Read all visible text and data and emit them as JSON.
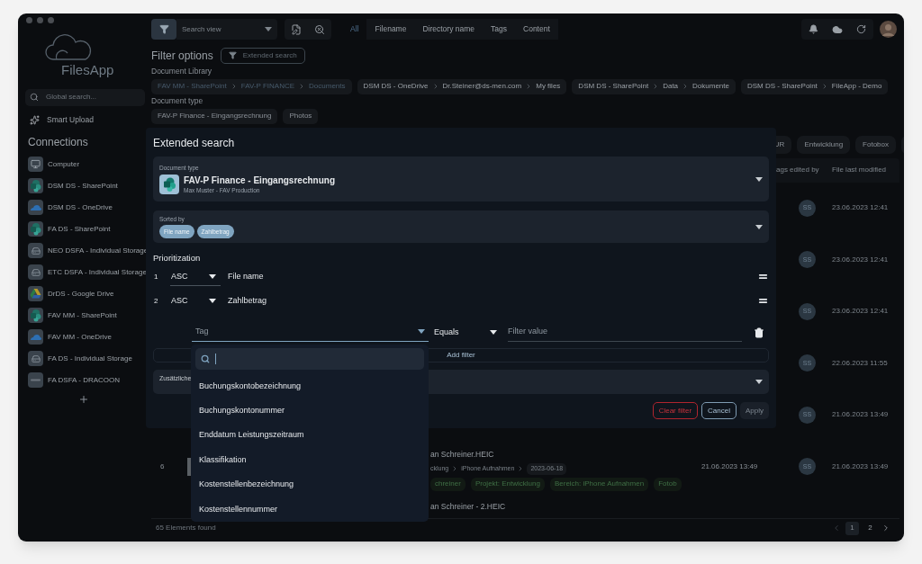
{
  "sidebar": {
    "brand": "FilesApp",
    "search": {
      "placeholder": "Global search..."
    },
    "smart_upload": "Smart Upload",
    "connections_title": "Connections",
    "connections": [
      {
        "label": "Computer",
        "kind": "computer"
      },
      {
        "label": "DSM DS - SharePoint",
        "kind": "sharepoint"
      },
      {
        "label": "DSM DS - OneDrive",
        "kind": "onedrive"
      },
      {
        "label": "FA DS - SharePoint",
        "kind": "sharepoint"
      },
      {
        "label": "NEO DSFA - Individual Storage",
        "kind": "storage"
      },
      {
        "label": "ETC DSFA - Individual Storage",
        "kind": "storage"
      },
      {
        "label": "DrDS - Google Drive",
        "kind": "gdrive"
      },
      {
        "label": "FAV MM - SharePoint",
        "kind": "sharepoint"
      },
      {
        "label": "FAV MM - OneDrive",
        "kind": "onedrive"
      },
      {
        "label": "FA DS - Individual Storage",
        "kind": "storage"
      },
      {
        "label": "FA DSFA - DRACOON",
        "kind": "dracoon"
      }
    ]
  },
  "toolbar": {
    "search_view": {
      "placeholder": "Search view"
    },
    "tabs": [
      {
        "label": "All",
        "selected": true
      },
      {
        "label": "Filename",
        "selected": false
      },
      {
        "label": "Directory name",
        "selected": false
      },
      {
        "label": "Tags",
        "selected": false
      },
      {
        "label": "Content",
        "selected": false
      }
    ]
  },
  "filter_options": {
    "title": "Filter options",
    "extended_search": "Extended search",
    "library_label": "Document Library",
    "libraries": [
      {
        "parts": [
          "FAV MM - SharePoint",
          "FAV-P FINANCE",
          "Documents"
        ],
        "selected": true
      },
      {
        "parts": [
          "DSM DS - OneDrive",
          "Dr.Steiner@ds-men.com",
          "My files"
        ],
        "selected": false
      },
      {
        "parts": [
          "DSM DS - SharePoint",
          "Data",
          "Dokumente"
        ],
        "selected": false
      },
      {
        "parts": [
          "DSM DS - SharePoint",
          "FileApp - Demo"
        ],
        "selected": false
      }
    ],
    "type_label": "Document type",
    "types": [
      "FAV-P Finance - Eingangsrechnung",
      "Photos"
    ],
    "tags": [
      "UR",
      "Entwicklung",
      "Fotobox"
    ]
  },
  "table": {
    "columns": [
      "ags edited by",
      "File last modified"
    ],
    "rows": [
      {
        "editor": "SS",
        "modified": "23.06.2023 12:41"
      },
      {
        "editor": "SS",
        "modified": "23.06.2023 12:41"
      },
      {
        "editor": "SS",
        "modified": "23.06.2023 12:41"
      },
      {
        "editor": "SS",
        "modified": "22.06.2023 11:55"
      },
      {
        "editor": "SS",
        "modified": "21.06.2023 13:49"
      },
      {
        "number": "6",
        "name": "an Schreiner.HEIC",
        "path": [
          "cklung",
          "iPhone Aufnahmen",
          "2023-06-18"
        ],
        "tags": [
          "chreiner",
          "Projekt: Entwicklung",
          "Bereich: iPhone Aufnahmen",
          "Fotob"
        ],
        "created": "21.06.2023 13:49",
        "editor": "SS",
        "modified": "21.06.2023 13:49"
      },
      {
        "name": "an Schreiner - 2.HEIC"
      }
    ]
  },
  "footer": {
    "count": "65 Elements found",
    "pages": [
      {
        "label": "1",
        "selected": true
      },
      {
        "label": "2",
        "selected": false
      }
    ]
  },
  "dialog": {
    "title": "Extended search",
    "document_type": {
      "label": "Document type",
      "value": "FAV-P Finance - Eingangsrechnung",
      "subtitle": "Max Muster - FAV Production"
    },
    "sorted_by": {
      "label": "Sorted by",
      "chips": [
        "File name",
        "Zahlbetrag"
      ]
    },
    "prioritization_title": "Prioritization",
    "prioritization": [
      {
        "index": "1",
        "order": "ASC",
        "field": "File name"
      },
      {
        "index": "2",
        "order": "ASC",
        "field": "Zahlbetrag"
      }
    ],
    "filter": {
      "field": {
        "placeholder": "Tag"
      },
      "operator": "Equals",
      "value": {
        "placeholder": "Filter value"
      }
    },
    "add_filter": "Add filter",
    "additional_label": "Zusätzliche",
    "buttons": [
      {
        "label": "Clear filter",
        "kind": "danger"
      },
      {
        "label": "Cancel",
        "kind": "outline"
      },
      {
        "label": "Apply",
        "kind": "disabled"
      }
    ]
  },
  "dropdown": {
    "items": [
      "Buchungskontobezeichnung",
      "Buchungskontonummer",
      "Enddatum Leistungszeitraum",
      "Klassifikation",
      "Kostenstellenbezeichnung",
      "Kostenstellennummer"
    ]
  }
}
